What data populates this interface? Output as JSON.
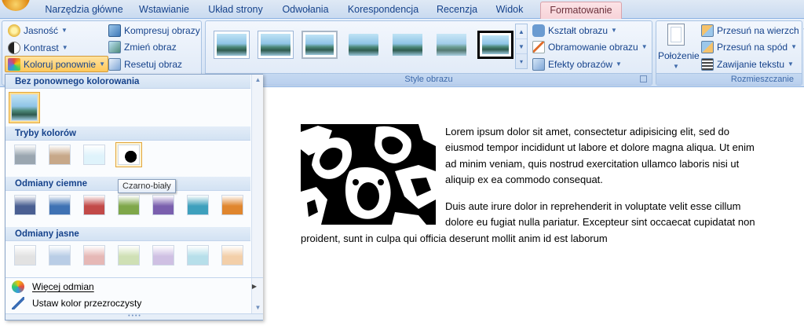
{
  "tabs": [
    {
      "label": "Narzędzia główne",
      "active": false
    },
    {
      "label": "Wstawianie",
      "active": false
    },
    {
      "label": "Układ strony",
      "active": false
    },
    {
      "label": "Odwołania",
      "active": false
    },
    {
      "label": "Korespondencja",
      "active": false
    },
    {
      "label": "Recenzja",
      "active": false
    },
    {
      "label": "Widok",
      "active": false
    },
    {
      "label": "Formatowanie",
      "active": true
    }
  ],
  "ribbon": {
    "adjust": {
      "brightness": "Jasność",
      "contrast": "Kontrast",
      "recolor": "Koloruj ponownie",
      "compress": "Kompresuj obrazy",
      "change": "Zmień obraz",
      "reset": "Resetuj obraz"
    },
    "picture_styles": {
      "label": "Style obrazu",
      "shape": "Kształt obrazu",
      "border": "Obramowanie obrazu",
      "effects": "Efekty obrazów"
    },
    "arrange": {
      "label": "Rozmieszczanie",
      "position": "Położenie",
      "bring_front": "Przesuń na wierzch",
      "send_back": "Przesuń na spód",
      "wrap": "Zawijanie tekstu"
    }
  },
  "recolor_menu": {
    "no_recolor_header": "Bez ponownego kolorowania",
    "color_modes_header": "Tryby kolorów",
    "dark_header": "Odmiany ciemne",
    "light_header": "Odmiany jasne",
    "more_variants": "Więcej odmian",
    "set_transparent": "Ustaw kolor przezroczysty",
    "tooltip": "Czarno-biały",
    "color_modes": [
      "#9aa6b0",
      "#c7a889",
      "#dff3fb",
      "#000000"
    ],
    "dark_variants": [
      "#4a5f92",
      "#3f72b4",
      "#c24a48",
      "#7fa74a",
      "#7a5fae",
      "#3ea0bd",
      "#e0862e"
    ],
    "light_variants": [
      "#e2e2e2",
      "#b9cde6",
      "#e6b8b6",
      "#cfe0b5",
      "#cfc0e3",
      "#b7dfea",
      "#f3cfa9"
    ]
  },
  "document": {
    "p1": "Lorem ipsum dolor sit amet, consectetur adipisicing elit, sed do",
    "p2": "eiusmod tempor incididunt ut labore et dolore magna aliqua. Ut enim",
    "p3": "ad minim veniam, quis nostrud exercitation ullamco laboris nisi ut",
    "p4": "aliquip ex ea commodo consequat.",
    "p5": "Duis aute irure dolor in reprehenderit in voluptate velit esse cillum",
    "p6": "dolore eu fugiat nulla pariatur. Excepteur sint occaecat cupidatat non",
    "p7": "proident, sunt in culpa qui officia deserunt mollit anim id est laborum"
  }
}
